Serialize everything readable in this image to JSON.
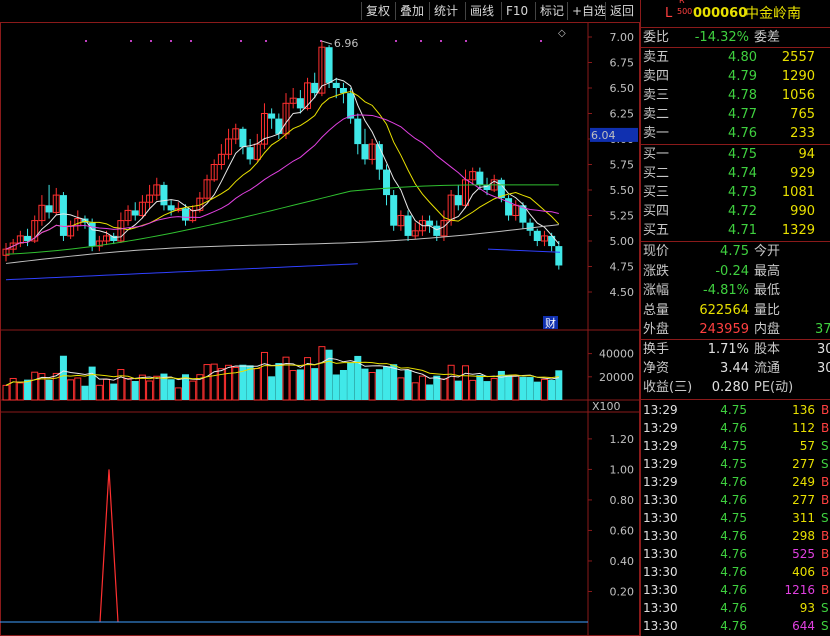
{
  "toolbar": {
    "buttons": [
      "复权",
      "叠加",
      "统计",
      "画线",
      "F10",
      "标记",
      "+自选",
      "返回"
    ]
  },
  "stock": {
    "prefix": "L",
    "badge_top": "R",
    "badge_bottom": "500",
    "code": "000060",
    "name": "中金岭南"
  },
  "order_book": {
    "webi_label": "委比",
    "webi_value": "-14.32%",
    "weicha_label": "委差",
    "asks": [
      {
        "label": "卖五",
        "price": "4.80",
        "vol": "2557"
      },
      {
        "label": "卖四",
        "price": "4.79",
        "vol": "1290"
      },
      {
        "label": "卖三",
        "price": "4.78",
        "vol": "1056"
      },
      {
        "label": "卖二",
        "price": "4.77",
        "vol": "765"
      },
      {
        "label": "卖一",
        "price": "4.76",
        "vol": "233"
      }
    ],
    "bids": [
      {
        "label": "买一",
        "price": "4.75",
        "vol": "94"
      },
      {
        "label": "买二",
        "price": "4.74",
        "vol": "929"
      },
      {
        "label": "买三",
        "price": "4.73",
        "vol": "1081"
      },
      {
        "label": "买四",
        "price": "4.72",
        "vol": "990"
      },
      {
        "label": "买五",
        "price": "4.71",
        "vol": "1329"
      }
    ]
  },
  "quote": {
    "rows": [
      {
        "l1": "现价",
        "v1": "4.75",
        "l2": "今开",
        "v2": ""
      },
      {
        "l1": "涨跌",
        "v1": "-0.24",
        "l2": "最高",
        "v2": ""
      },
      {
        "l1": "涨幅",
        "v1": "-4.81%",
        "l2": "最低",
        "v2": ""
      },
      {
        "l1": "总量",
        "v1": "622564",
        "l2": "量比",
        "v2": ""
      },
      {
        "l1": "外盘",
        "v1": "243959",
        "l2": "内盘",
        "v2": "37"
      }
    ],
    "rows2": [
      {
        "l1": "换手",
        "v1": "1.71%",
        "l2": "股本",
        "v2": "30"
      },
      {
        "l1": "净资",
        "v1": "3.44",
        "l2": "流通",
        "v2": "30"
      },
      {
        "l1": "收益(三)",
        "v1": "0.280",
        "l2": "PE(动)",
        "v2": ""
      }
    ]
  },
  "ticks": [
    {
      "time": "13:29",
      "price": "4.75",
      "vol": "136",
      "side": "B"
    },
    {
      "time": "13:29",
      "price": "4.76",
      "vol": "112",
      "side": "B"
    },
    {
      "time": "13:29",
      "price": "4.75",
      "vol": "57",
      "side": "S"
    },
    {
      "time": "13:29",
      "price": "4.75",
      "vol": "277",
      "side": "S"
    },
    {
      "time": "13:29",
      "price": "4.76",
      "vol": "249",
      "side": "B"
    },
    {
      "time": "13:30",
      "price": "4.76",
      "vol": "277",
      "side": "B"
    },
    {
      "time": "13:30",
      "price": "4.75",
      "vol": "311",
      "side": "S"
    },
    {
      "time": "13:30",
      "price": "4.76",
      "vol": "298",
      "side": "B"
    },
    {
      "time": "13:30",
      "price": "4.76",
      "vol": "525",
      "side": "B"
    },
    {
      "time": "13:30",
      "price": "4.76",
      "vol": "406",
      "side": "B"
    },
    {
      "time": "13:30",
      "price": "4.76",
      "vol": "1216",
      "side": "B"
    },
    {
      "time": "13:30",
      "price": "4.76",
      "vol": "93",
      "side": "S"
    },
    {
      "time": "13:30",
      "price": "4.76",
      "vol": "644",
      "side": "S"
    }
  ],
  "colors": {
    "up": "#ff3030",
    "down": "#40e8e8",
    "frame": "#8a1a1a",
    "ma5": "#e8e8e8",
    "ma10": "#e8e000",
    "ma20": "#e040e0",
    "ma60": "#30c030",
    "ma120": "#c0c0c0",
    "ma250": "#3040ff"
  },
  "chart_data": [
    {
      "type": "candlestick",
      "title": "",
      "ylim": [
        4.5,
        7.0
      ],
      "y_ticks": [
        "7.00",
        "6.75",
        "6.50",
        "6.25",
        "6.00",
        "5.75",
        "5.50",
        "5.25",
        "5.00",
        "4.75",
        "4.50"
      ],
      "current_price_label": "6.04",
      "high_annotation": "6.96",
      "finance_marker": "财",
      "candles": [
        [
          4.86,
          4.92,
          4.8,
          4.98
        ],
        [
          4.92,
          4.98,
          4.88,
          5.02
        ],
        [
          4.98,
          5.05,
          4.94,
          5.1
        ],
        [
          5.05,
          5.0,
          4.95,
          5.12
        ],
        [
          5.0,
          5.2,
          4.98,
          5.25
        ],
        [
          5.2,
          5.35,
          5.15,
          5.45
        ],
        [
          5.35,
          5.28,
          5.22,
          5.55
        ],
        [
          5.28,
          5.45,
          5.25,
          5.52
        ],
        [
          5.45,
          5.05,
          5.0,
          5.48
        ],
        [
          5.05,
          5.15,
          5.02,
          5.2
        ],
        [
          5.15,
          5.22,
          5.1,
          5.3
        ],
        [
          5.22,
          5.18,
          5.12,
          5.25
        ],
        [
          5.18,
          4.95,
          4.9,
          5.22
        ],
        [
          4.95,
          5.0,
          4.9,
          5.05
        ],
        [
          5.0,
          5.05,
          4.96,
          5.1
        ],
        [
          5.05,
          5.0,
          4.97,
          5.08
        ],
        [
          5.0,
          5.2,
          4.98,
          5.28
        ],
        [
          5.2,
          5.3,
          5.15,
          5.35
        ],
        [
          5.3,
          5.25,
          5.2,
          5.38
        ],
        [
          5.25,
          5.38,
          5.22,
          5.45
        ],
        [
          5.38,
          5.45,
          5.32,
          5.55
        ],
        [
          5.45,
          5.55,
          5.4,
          5.62
        ],
        [
          5.55,
          5.35,
          5.3,
          5.58
        ],
        [
          5.35,
          5.3,
          5.25,
          5.4
        ],
        [
          5.3,
          5.32,
          5.28,
          5.38
        ],
        [
          5.32,
          5.2,
          5.15,
          5.36
        ],
        [
          5.2,
          5.3,
          5.18,
          5.35
        ],
        [
          5.3,
          5.42,
          5.28,
          5.48
        ],
        [
          5.42,
          5.6,
          5.4,
          5.65
        ],
        [
          5.6,
          5.75,
          5.58,
          5.8
        ],
        [
          5.75,
          5.85,
          5.7,
          5.95
        ],
        [
          5.85,
          6.0,
          5.8,
          6.1
        ],
        [
          6.0,
          6.1,
          5.95,
          6.15
        ],
        [
          6.1,
          5.92,
          5.85,
          6.12
        ],
        [
          5.92,
          5.8,
          5.75,
          6.0
        ],
        [
          5.8,
          5.95,
          5.78,
          6.05
        ],
        [
          5.95,
          6.25,
          5.9,
          6.35
        ],
        [
          6.25,
          6.2,
          6.1,
          6.3
        ],
        [
          6.2,
          6.05,
          6.0,
          6.25
        ],
        [
          6.05,
          6.35,
          6.0,
          6.45
        ],
        [
          6.35,
          6.4,
          6.3,
          6.5
        ],
        [
          6.4,
          6.3,
          6.25,
          6.48
        ],
        [
          6.3,
          6.55,
          6.28,
          6.6
        ],
        [
          6.55,
          6.45,
          6.4,
          6.65
        ],
        [
          6.45,
          6.9,
          6.42,
          6.96
        ],
        [
          6.9,
          6.55,
          6.5,
          6.92
        ],
        [
          6.55,
          6.5,
          6.4,
          6.6
        ],
        [
          6.5,
          6.45,
          6.35,
          6.55
        ],
        [
          6.45,
          6.2,
          6.15,
          6.5
        ],
        [
          6.2,
          5.95,
          5.85,
          6.25
        ],
        [
          5.95,
          5.8,
          5.75,
          6.1
        ],
        [
          5.8,
          5.95,
          5.75,
          6.0
        ],
        [
          5.95,
          5.7,
          5.6,
          5.98
        ],
        [
          5.7,
          5.45,
          5.35,
          5.75
        ],
        [
          5.45,
          5.15,
          5.1,
          5.5
        ],
        [
          5.15,
          5.25,
          5.1,
          5.3
        ],
        [
          5.25,
          5.05,
          5.0,
          5.3
        ],
        [
          5.05,
          5.1,
          5.02,
          5.18
        ],
        [
          5.1,
          5.2,
          5.05,
          5.25
        ],
        [
          5.2,
          5.15,
          5.08,
          5.25
        ],
        [
          5.15,
          5.05,
          5.0,
          5.2
        ],
        [
          5.05,
          5.2,
          5.0,
          5.3
        ],
        [
          5.2,
          5.45,
          5.15,
          5.5
        ],
        [
          5.45,
          5.35,
          5.3,
          5.55
        ],
        [
          5.35,
          5.6,
          5.32,
          5.7
        ],
        [
          5.6,
          5.68,
          5.55,
          5.72
        ],
        [
          5.68,
          5.55,
          5.5,
          5.72
        ],
        [
          5.55,
          5.5,
          5.45,
          5.62
        ],
        [
          5.5,
          5.6,
          5.48,
          5.65
        ],
        [
          5.6,
          5.42,
          5.38,
          5.62
        ],
        [
          5.42,
          5.25,
          5.2,
          5.45
        ],
        [
          5.25,
          5.35,
          5.2,
          5.4
        ],
        [
          5.35,
          5.18,
          5.12,
          5.38
        ],
        [
          5.18,
          5.1,
          5.05,
          5.22
        ],
        [
          5.1,
          5.0,
          4.95,
          5.12
        ],
        [
          5.0,
          5.05,
          4.95,
          5.1
        ],
        [
          5.05,
          4.95,
          4.9,
          5.08
        ],
        [
          4.95,
          4.76,
          4.72,
          5.0
        ]
      ]
    },
    {
      "type": "bar",
      "title": "",
      "ylim": [
        0,
        50000
      ],
      "y_ticks": [
        "40000",
        "20000"
      ],
      "unit_label": "X100"
    },
    {
      "type": "line",
      "title": "",
      "ylim": [
        0,
        1.35
      ],
      "y_ticks": [
        "1.20",
        "1.00",
        "0.80",
        "0.60",
        "0.40",
        "0.20"
      ],
      "peak": {
        "x_index": 24,
        "y": 1.0
      }
    }
  ]
}
